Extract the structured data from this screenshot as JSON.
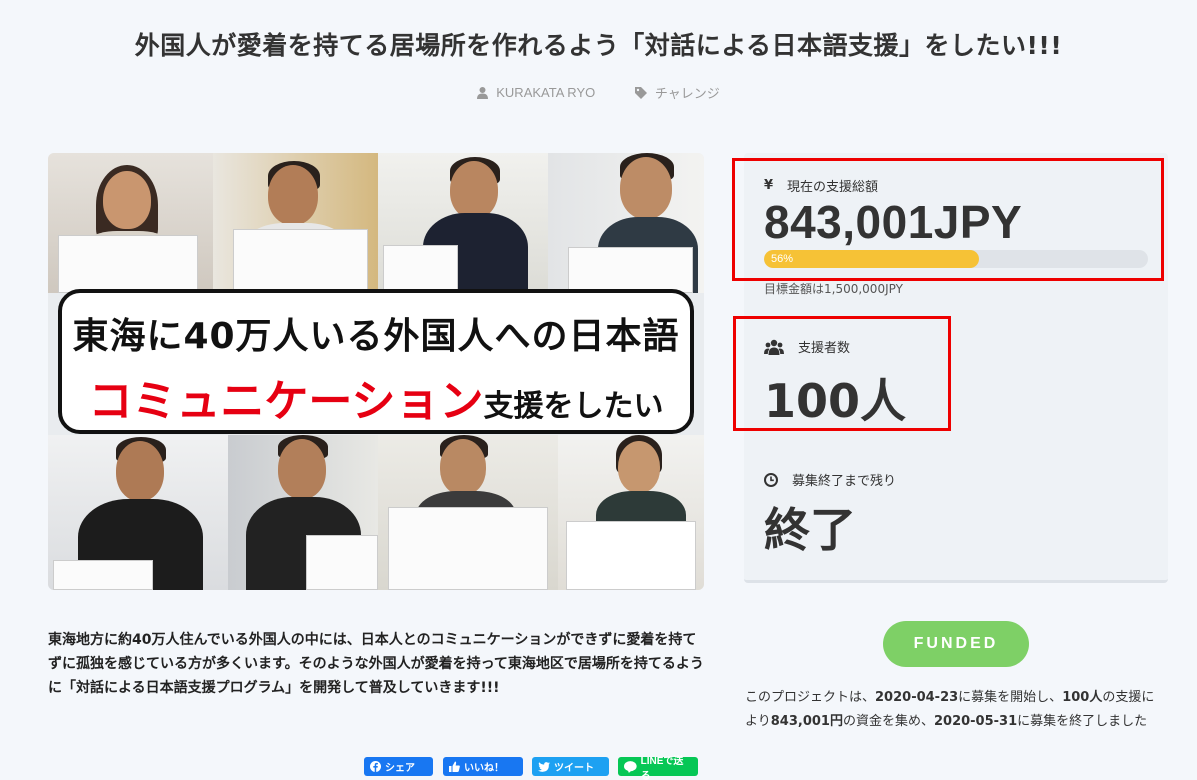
{
  "project": {
    "title": "外国人が愛着を持てる居場所を作れるよう「対話による日本語支援」をしたい!!!",
    "author": "KURAKATA RYO",
    "category": "チャレンジ"
  },
  "hero": {
    "banner_line1": "東海に40万人いる外国人への日本語",
    "banner_line2_red": "コミュニケーション",
    "banner_line2_black": "支援をしたい"
  },
  "description": "東海地方に約40万人住んでいる外国人の中には、日本人とのコミュニケーションができずに愛着を持てずに孤独を感じている方が多くいます。そのような外国人が愛着を持って東海地区で居場所を持てるように「対話による日本語支援プログラム」を開発して普及していきます!!!",
  "share": {
    "facebook": "シェア",
    "like": "いいね！",
    "twitter": "ツイート",
    "line": "LINEで送る"
  },
  "stats": {
    "amount_label": "現在の支援総額",
    "amount_value": "843,001JPY",
    "progress_percent": 56,
    "progress_text": "56%",
    "goal_text": "目標金額は1,500,000JPY",
    "backers_label": "支援者数",
    "backers_value": "100人",
    "remaining_label": "募集終了まで残り",
    "remaining_value": "終了"
  },
  "funded_label": "FUNDED",
  "summary": {
    "p1": "このプロジェクトは、",
    "start": "2020-04-23",
    "p2": "に募集を開始し、",
    "backers": "100人",
    "p3": "の支援により",
    "amount": "843,001円",
    "p4": "の資金を集め、",
    "end": "2020-05-31",
    "p5": "に募集を終了しました"
  },
  "colors": {
    "accent_green": "#7ed066",
    "progress_yellow": "#f6c236",
    "highlight_red": "#e00000",
    "facebook_blue": "#1877f2",
    "twitter_blue": "#1da1f2",
    "line_green": "#06c755"
  }
}
